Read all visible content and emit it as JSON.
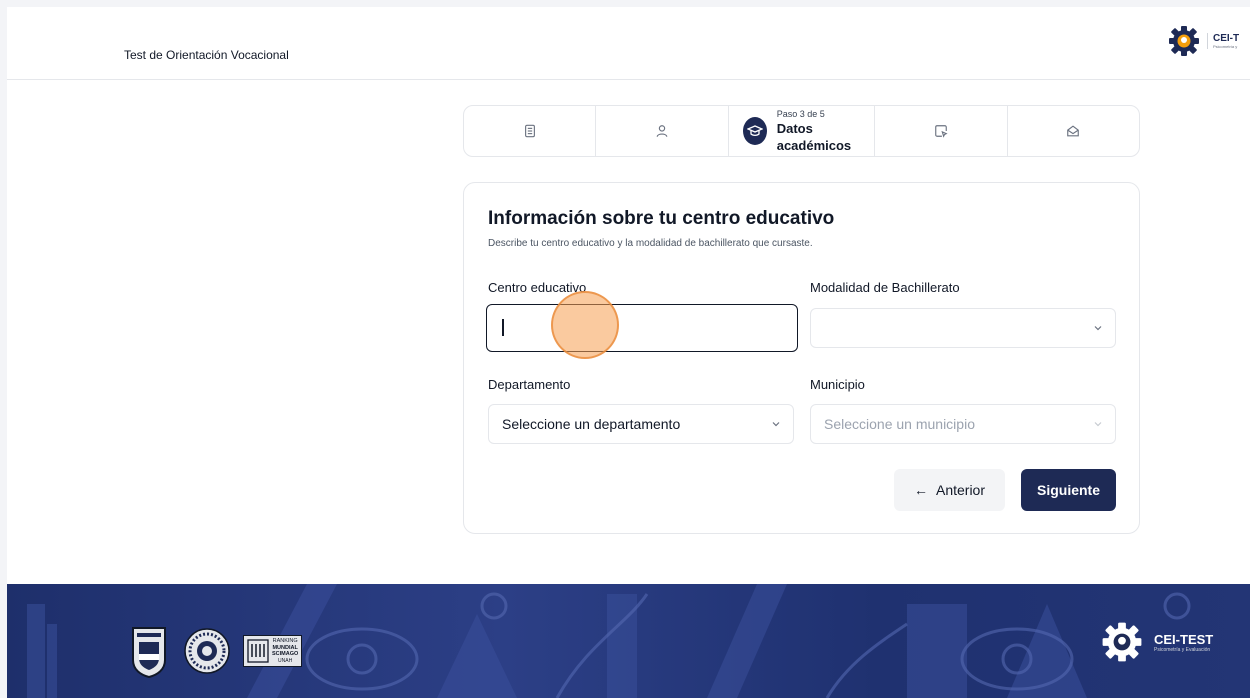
{
  "header": {
    "app_title": "Test de Orientación Vocacional",
    "brand_name": "CEI-T",
    "brand_sub": "Psicometría y"
  },
  "stepper": {
    "current_step": 3,
    "total_steps": 5,
    "steps": [
      {
        "icon": "document-icon"
      },
      {
        "icon": "user-icon"
      },
      {
        "icon": "graduation-cap-icon",
        "step_label": "Paso 3 de 5",
        "title": "Datos académicos"
      },
      {
        "icon": "clipboard-pointer-icon"
      },
      {
        "icon": "envelope-open-icon"
      }
    ]
  },
  "form": {
    "title": "Información sobre tu centro educativo",
    "subtitle": "Describe tu centro educativo y la modalidad de bachillerato que cursaste.",
    "centro_label": "Centro educativo",
    "centro_value": "",
    "modalidad_label": "Modalidad de Bachillerato",
    "modalidad_value": "",
    "departamento_label": "Departamento",
    "departamento_value": "Seleccione un departamento",
    "municipio_label": "Municipio",
    "municipio_value": "Seleccione un municipio",
    "prev_label": "Anterior",
    "next_label": "Siguiente"
  },
  "footer": {
    "ranking_line1": "RANKING",
    "ranking_line2": "MUNDIAL",
    "ranking_line3": "SCIMAGO",
    "ranking_line4": "UNAH",
    "brand_name": "CEI-TEST",
    "brand_sub": "Psicometría y Evaluación"
  },
  "colors": {
    "primary": "#1e2a55",
    "footer_bg": "#2c3f86",
    "click_marker": "#f59e50"
  }
}
